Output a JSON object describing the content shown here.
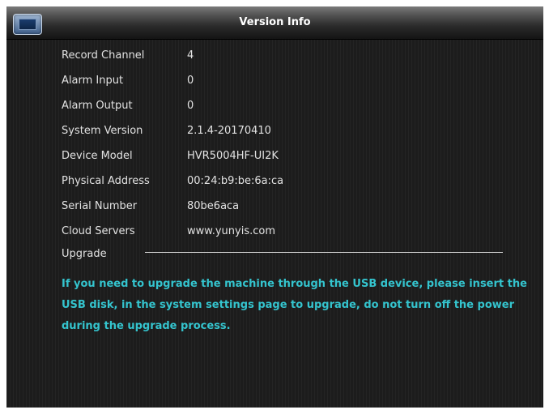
{
  "window": {
    "title": "Version Info"
  },
  "info": [
    {
      "label": "Record Channel",
      "value": "4"
    },
    {
      "label": "Alarm Input",
      "value": "0"
    },
    {
      "label": "Alarm Output",
      "value": "0"
    },
    {
      "label": "System Version",
      "value": "2.1.4-20170410"
    },
    {
      "label": "Device Model",
      "value": "HVR5004HF-UI2K"
    },
    {
      "label": "Physical Address",
      "value": "00:24:b9:be:6a:ca"
    },
    {
      "label": "Serial Number",
      "value": "80be6aca"
    },
    {
      "label": "Cloud Servers",
      "value": "www.yunyis.com"
    }
  ],
  "upgrade": {
    "title": "Upgrade",
    "message": "If you need to upgrade the machine through the USB device, please insert the USB disk, in the system settings page to upgrade, do not turn off the power during the upgrade process."
  },
  "colors": {
    "accent_text": "#34c4ce",
    "background": "#1c1c1c"
  }
}
